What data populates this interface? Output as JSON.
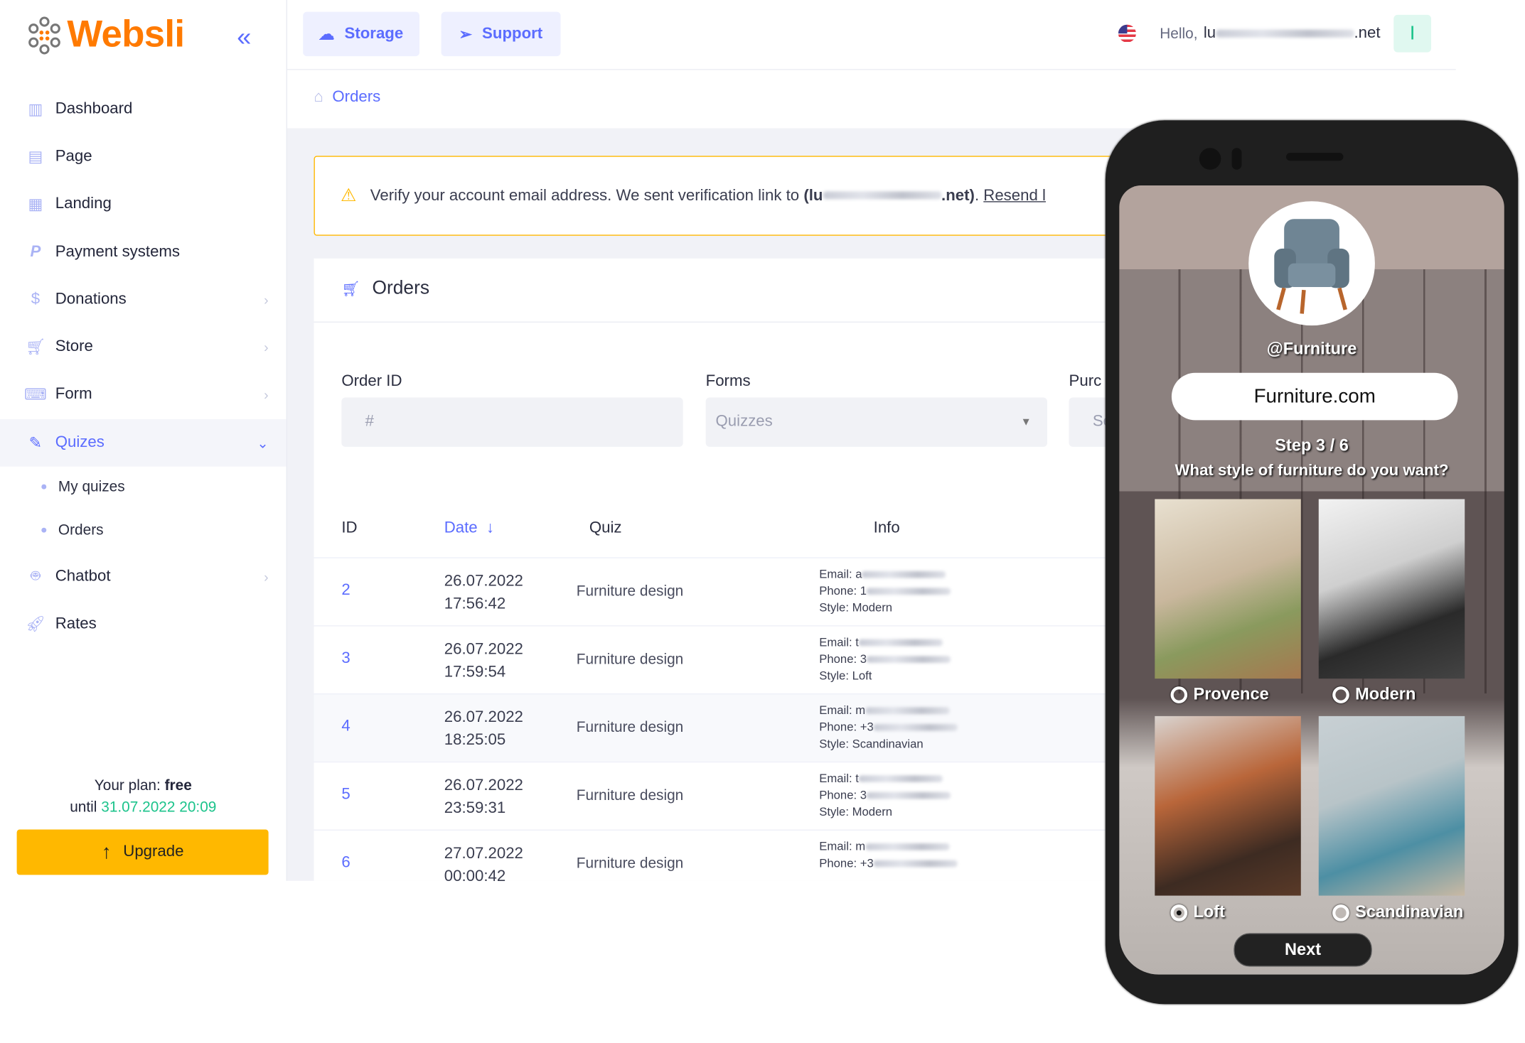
{
  "brand": {
    "name": "Websli",
    "color": "#ff7a00"
  },
  "colors": {
    "accent": "#5b6cff",
    "warning": "#ffb800",
    "success": "#1cc38b"
  },
  "sidebar": {
    "items": [
      {
        "label": "Dashboard",
        "icon": "bar-chart-icon"
      },
      {
        "label": "Page",
        "icon": "page-icon"
      },
      {
        "label": "Landing",
        "icon": "landing-icon"
      },
      {
        "label": "Payment systems",
        "icon": "paypal-icon"
      },
      {
        "label": "Donations",
        "icon": "dollar-icon"
      },
      {
        "label": "Store",
        "icon": "cart-icon"
      },
      {
        "label": "Form",
        "icon": "keyboard-icon"
      },
      {
        "label": "Quizes",
        "icon": "quiz-icon"
      },
      {
        "label": "Chatbot",
        "icon": "robot-icon"
      },
      {
        "label": "Rates",
        "icon": "rocket-icon"
      }
    ],
    "sub_items": [
      {
        "label": "My quizes"
      },
      {
        "label": "Orders"
      }
    ],
    "plan": {
      "prefix": "Your plan:",
      "name": "free",
      "until_label": "until",
      "until_date": "31.07.2022 20:09"
    },
    "upgrade_label": "Upgrade"
  },
  "header": {
    "storage_label": "Storage",
    "support_label": "Support",
    "hello": "Hello,",
    "user_prefix": "lu",
    "user_suffix": ".net",
    "avatar_letter": "I"
  },
  "breadcrumb": {
    "current": "Orders"
  },
  "alert": {
    "text": "Verify your account email address. We sent verification link to",
    "email_prefix": "(lu",
    "email_suffix": ".net)",
    "link": "Resend l"
  },
  "orders": {
    "title": "Orders",
    "filters": {
      "order_id_label": "Order ID",
      "order_id_placeholder": "#",
      "forms_label": "Forms",
      "forms_value": "Quizzes",
      "purchase_label": "Purc",
      "purchase_placeholder": "Se"
    },
    "columns": {
      "id": "ID",
      "date": "Date",
      "quiz": "Quiz",
      "info": "Info"
    },
    "rows": [
      {
        "id": "2",
        "date": "26.07.2022",
        "time": "17:56:42",
        "quiz": "Furniture design",
        "email": "Email: a",
        "phone": "Phone: 1",
        "style": "Style: Modern"
      },
      {
        "id": "3",
        "date": "26.07.2022",
        "time": "17:59:54",
        "quiz": "Furniture design",
        "email": "Email: t",
        "phone": "Phone: 3",
        "style": "Style: Loft"
      },
      {
        "id": "4",
        "date": "26.07.2022",
        "time": "18:25:05",
        "quiz": "Furniture design",
        "email": "Email: m",
        "phone": "Phone: +3",
        "style": "Style: Scandinavian"
      },
      {
        "id": "5",
        "date": "26.07.2022",
        "time": "23:59:31",
        "quiz": "Furniture design",
        "email": "Email: t",
        "phone": "Phone: 3",
        "style": "Style: Modern"
      },
      {
        "id": "6",
        "date": "27.07.2022",
        "time": "00:00:42",
        "quiz": "Furniture design",
        "email": "Email: m",
        "phone": "Phone: +3",
        "style": ""
      }
    ]
  },
  "phone": {
    "handle": "@Furniture",
    "site": "Furniture.com",
    "step": "Step 3 / 6",
    "question": "What style of furniture do you want?",
    "options": [
      {
        "label": "Provence",
        "selected": false
      },
      {
        "label": "Modern",
        "selected": false
      },
      {
        "label": "Loft",
        "selected": true
      },
      {
        "label": "Scandinavian",
        "selected": false
      }
    ],
    "next_label": "Next"
  }
}
